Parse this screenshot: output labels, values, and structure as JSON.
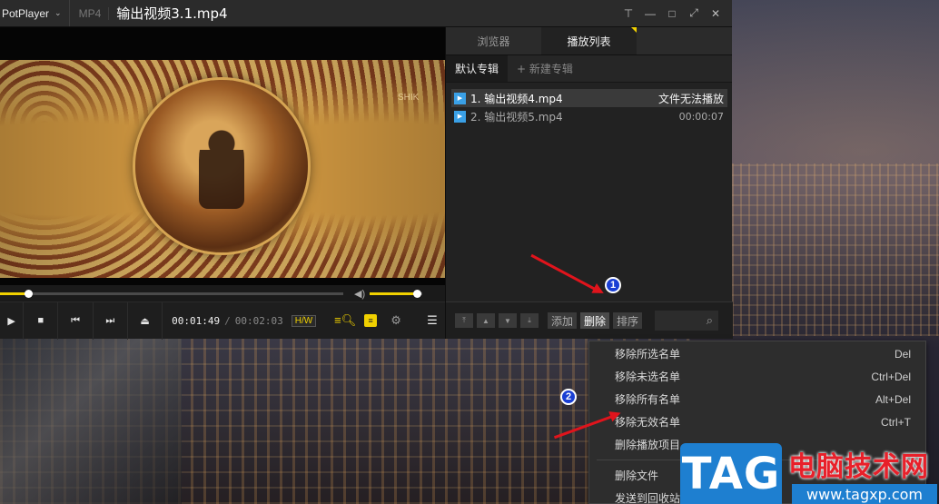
{
  "titlebar": {
    "app_name": "PotPlayer",
    "format": "MP4",
    "file_title": "输出视频3.1.mp4"
  },
  "window_controls": [
    "pin-icon",
    "minimize-icon",
    "maximize-icon",
    "fullscreen-icon",
    "close-icon"
  ],
  "player": {
    "current_time": "00:01:49",
    "separator": "/",
    "total_time": "00:02:03",
    "hw_label": "H/W",
    "seek_progress": 0.081,
    "volume_level": 0.9,
    "video_watermark": "SHIK"
  },
  "panel": {
    "tabs": [
      {
        "label": "浏览器",
        "active": false
      },
      {
        "label": "播放列表",
        "active": true
      }
    ],
    "albums": [
      {
        "label": "默认专辑",
        "active": true
      },
      {
        "label": "+ 新建专辑",
        "active": false
      }
    ],
    "items": [
      {
        "name": "1. 输出视频4.mp4",
        "info": "文件无法播放",
        "selected": true
      },
      {
        "name": "2. 输出视频5.mp4",
        "info": "00:00:07",
        "selected": false
      }
    ],
    "buttons": {
      "add": "添加",
      "delete": "删除",
      "sort": "排序"
    }
  },
  "context_menu": {
    "items": [
      {
        "label": "移除所选名单",
        "shortcut": "Del"
      },
      {
        "label": "移除未选名单",
        "shortcut": "Ctrl+Del"
      },
      {
        "label": "移除所有名单",
        "shortcut": "Alt+Del"
      },
      {
        "label": "移除无效名单",
        "shortcut": "Ctrl+T"
      },
      {
        "label": "删除播放项目",
        "shortcut": ""
      },
      {
        "label": "删除文件",
        "shortcut": ""
      },
      {
        "label": "发送到回收站",
        "shortcut": ""
      }
    ]
  },
  "annotations": {
    "step1": "1",
    "step2": "2"
  },
  "watermark": {
    "logo": "TAG",
    "site_name": "电脑技术网",
    "url": "www.tagxp.com"
  },
  "colors": {
    "accent": "#f0d000",
    "badge": "#3aa0e6",
    "annotation_circle": "#1a3fd4",
    "arrow": "#e0141c"
  }
}
